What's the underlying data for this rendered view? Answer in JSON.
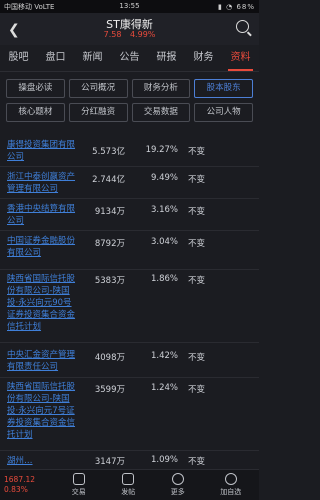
{
  "statusbar": {
    "carrier": "中国移动 VoLTE",
    "time": "13:55",
    "indicators": "▮ ◔ 68%"
  },
  "header": {
    "title": "ST康得新",
    "price": "7.58",
    "change_pct": "4.99%"
  },
  "tabs": [
    "股吧",
    "盘口",
    "新闻",
    "公告",
    "研报",
    "财务",
    "资料"
  ],
  "active_tab": 6,
  "subtabs": [
    "操盘必读",
    "公司概况",
    "财务分析",
    "股本股东",
    "核心题材",
    "分红融资",
    "交易数据",
    "公司人物"
  ],
  "active_subtab": 3,
  "holders": [
    {
      "name": "康得投资集团有限公司",
      "amount": "5.573亿",
      "pct": "19.27%",
      "change": "不变"
    },
    {
      "name": "浙江中泰创赢资产管理有限公司",
      "amount": "2.744亿",
      "pct": "9.49%",
      "change": "不变"
    },
    {
      "name": "香港中央结算有限公司",
      "amount": "9134万",
      "pct": "3.16%",
      "change": "不变"
    },
    {
      "name": "中国证券金融股份有限公司",
      "amount": "8792万",
      "pct": "3.04%",
      "change": "不变"
    },
    {
      "name": "陕西省国际信托股份有限公司-陕国投·永兴向元90号证券投资集合资金信托计划",
      "amount": "5383万",
      "pct": "1.86%",
      "change": "不变"
    },
    {
      "name": "中央汇金资产管理有限责任公司",
      "amount": "4098万",
      "pct": "1.42%",
      "change": "不变"
    },
    {
      "name": "陕西省国际信托股份有限公司-陕国投·永兴向元7号证券投资集合资金信托计划",
      "amount": "3599万",
      "pct": "1.24%",
      "change": "不变"
    },
    {
      "name": "湖州…",
      "amount": "3147万",
      "pct": "1.09%",
      "change": "不变"
    }
  ],
  "index": {
    "value": "1687.12",
    "change": "0.83%"
  },
  "bottom_nav": [
    {
      "label": "交易",
      "icon": "trade-icon"
    },
    {
      "label": "发帖",
      "icon": "post-icon"
    },
    {
      "label": "更多",
      "icon": "more-icon"
    },
    {
      "label": "加自选",
      "icon": "add-watchlist-icon"
    }
  ]
}
